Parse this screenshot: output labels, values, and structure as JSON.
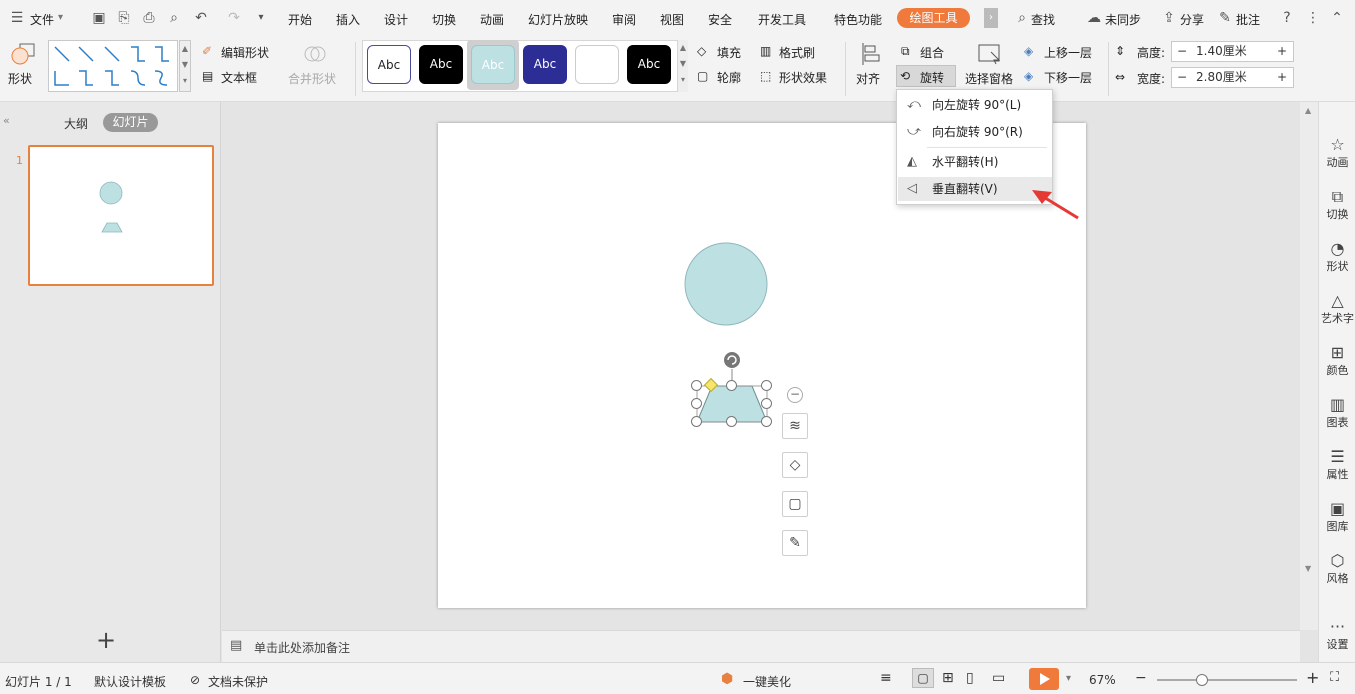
{
  "menubar": {
    "file_label": "文件",
    "tabs": [
      "开始",
      "插入",
      "设计",
      "切换",
      "动画",
      "幻灯片放映",
      "审阅",
      "视图",
      "安全",
      "开发工具",
      "特色功能"
    ],
    "active_tab": "绘图工具",
    "search": "查找",
    "sync": "未同步",
    "share": "分享",
    "comment": "批注"
  },
  "ribbon": {
    "shape_label": "形状",
    "edit_shape": "编辑形状",
    "text_box": "文本框",
    "merge_shape": "合并形状",
    "style_samples": [
      "Abc",
      "Abc",
      "Abc",
      "Abc",
      "",
      "Abc"
    ],
    "fill": "填充",
    "format_brush": "格式刷",
    "outline": "轮廓",
    "shape_effect": "形状效果",
    "align": "对齐",
    "group": "组合",
    "rotate": "旋转",
    "selection_pane": "选择窗格",
    "bring_forward": "上移一层",
    "send_backward": "下移一层",
    "height_label": "高度:",
    "height_value": "1.40厘米",
    "width_label": "宽度:",
    "width_value": "2.80厘米"
  },
  "rotate_menu": {
    "items": [
      "向左旋转 90°(L)",
      "向右旋转 90°(R)",
      "水平翻转(H)",
      "垂直翻转(V)"
    ]
  },
  "left_pane": {
    "tab_outline": "大纲",
    "tab_slides": "幻灯片",
    "slide_number": "1",
    "add": "+"
  },
  "notes": {
    "placeholder": "单击此处添加备注"
  },
  "right_bar": {
    "items": [
      "动画",
      "切换",
      "形状",
      "艺术字",
      "颜色",
      "图表",
      "属性",
      "图库",
      "风格",
      "设置"
    ]
  },
  "status": {
    "slide_info": "幻灯片 1 / 1",
    "template": "默认设计模板",
    "protect": "文档未保护",
    "beautify": "一键美化",
    "zoom": "67%"
  },
  "colors": {
    "accent": "#f07a3c",
    "shape_fill": "#bde0e3",
    "arrow": "#e53935"
  }
}
